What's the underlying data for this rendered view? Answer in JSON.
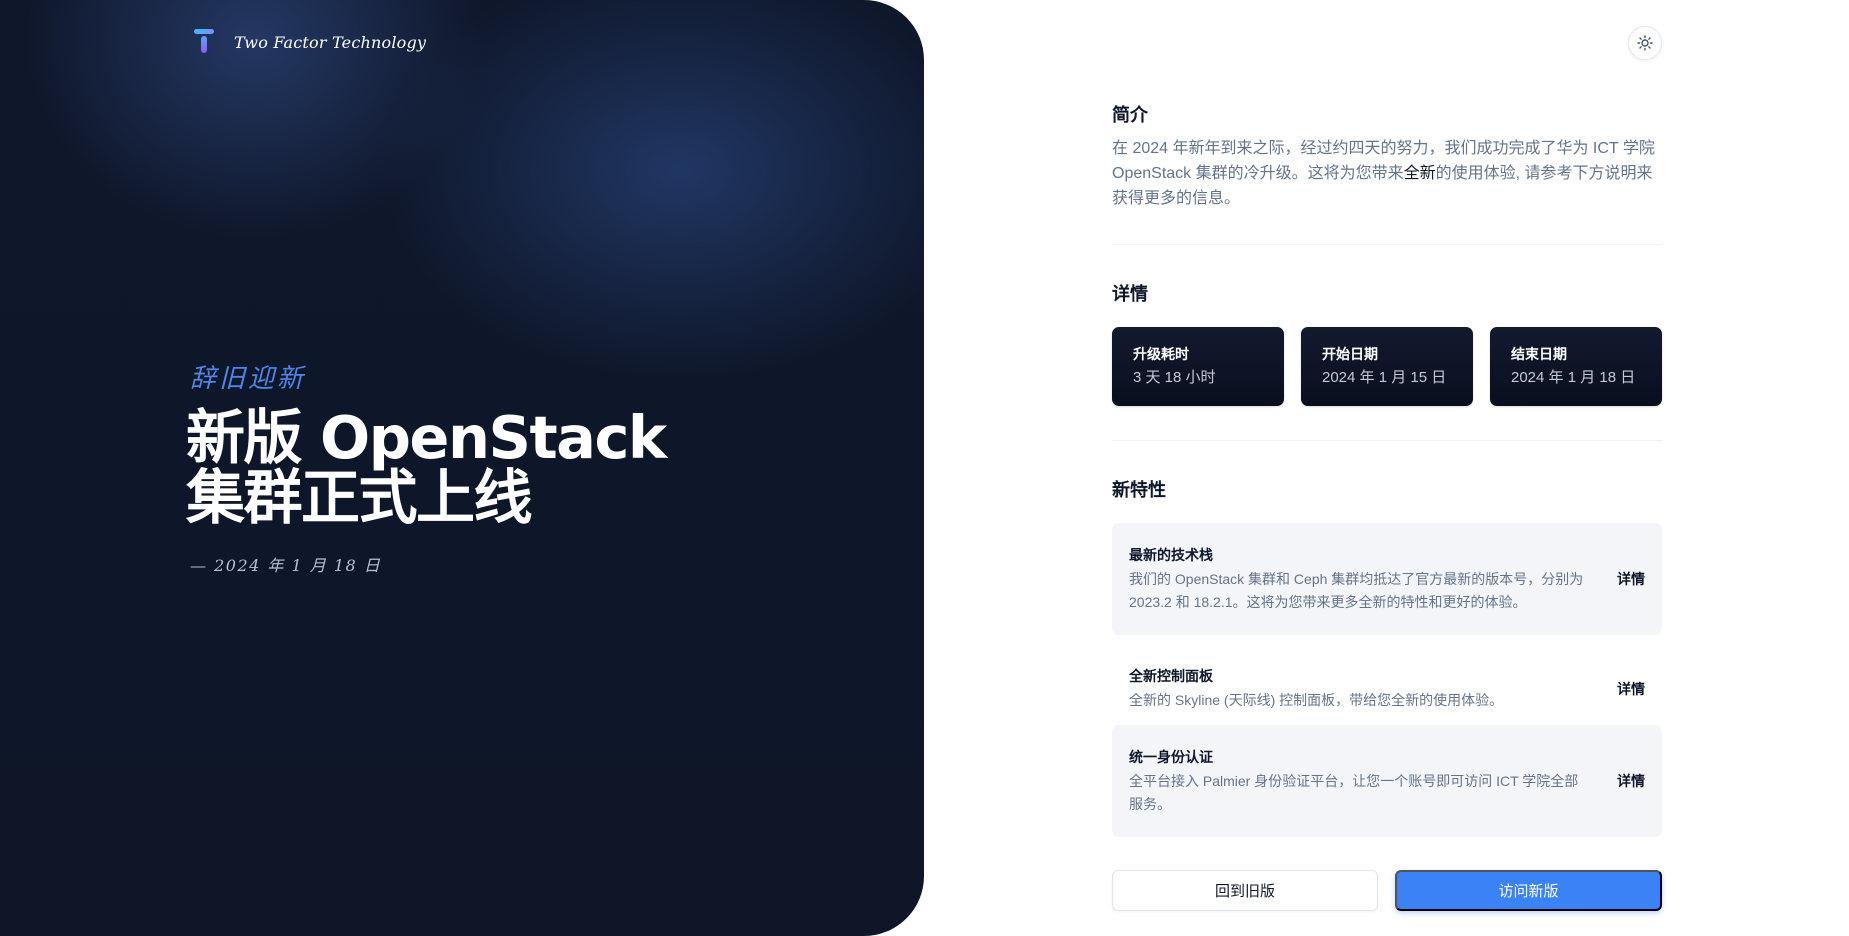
{
  "brand": {
    "name": "Two Factor Technology",
    "logo_icon": "t-logo-icon"
  },
  "hero": {
    "eyebrow": "辞旧迎新",
    "title": "新版 OpenStack 集群正式上线",
    "date": "— 2024 年 1 月 18 日"
  },
  "theme_toggle": {
    "icon": "sun-icon"
  },
  "intro": {
    "heading": "简介",
    "text_before": "在 2024 年新年到来之际，经过约四天的努力，我们成功完成了华为 ICT 学院 OpenStack 集群的冷升级。这将为您带来",
    "highlight": "全新",
    "text_after": "的使用体验, 请参考下方说明来获得更多的信息。"
  },
  "details": {
    "heading": "详情",
    "cards": [
      {
        "label": "升级耗时",
        "value": "3 天 18 小时"
      },
      {
        "label": "开始日期",
        "value": "2024 年 1 月 15 日"
      },
      {
        "label": "结束日期",
        "value": "2024 年 1 月 18 日"
      }
    ]
  },
  "features": {
    "heading": "新特性",
    "items": [
      {
        "title": "最新的技术栈",
        "desc": "我们的 OpenStack 集群和 Ceph 集群均抵达了官方最新的版本号，分别为 2023.2 和 18.2.1。这将为您带来更多全新的特性和更好的体验。",
        "link": "详情"
      },
      {
        "title": "全新控制面板",
        "desc": "全新的 Skyline (天际线) 控制面板，带给您全新的使用体验。",
        "link": "详情"
      },
      {
        "title": "统一身份认证",
        "desc": "全平台接入 Palmier 身份验证平台，让您一个账号即可访问 ICT 学院全部服务。",
        "link": "详情"
      }
    ]
  },
  "actions": {
    "old_label": "回到旧版",
    "new_label": "访问新版"
  },
  "colors": {
    "accent": "#3b82f6",
    "hero_bg": "#0f172a",
    "eyebrow": "#4f86e8"
  }
}
